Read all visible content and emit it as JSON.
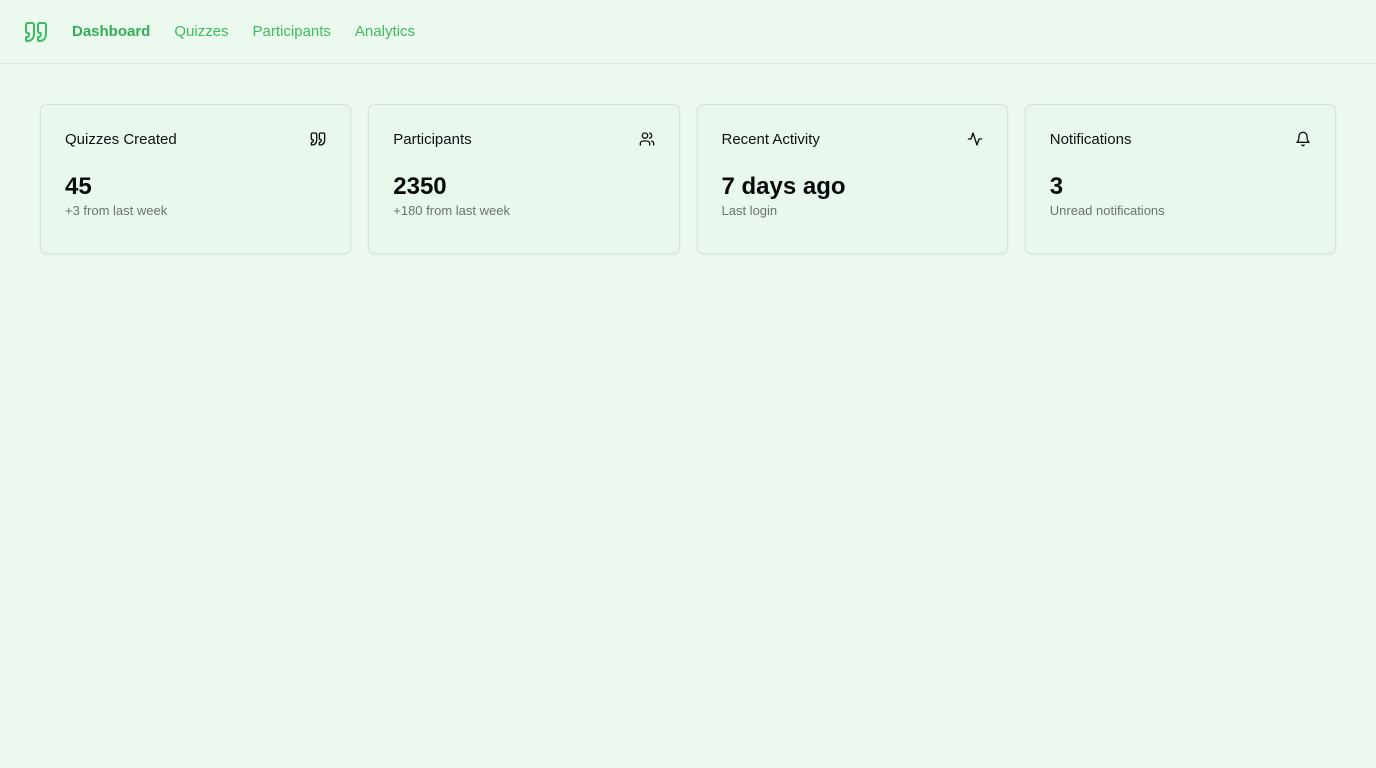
{
  "nav": {
    "logo_icon": "quote-icon",
    "items": [
      {
        "label": "Dashboard",
        "active": true
      },
      {
        "label": "Quizzes",
        "active": false
      },
      {
        "label": "Participants",
        "active": false
      },
      {
        "label": "Analytics",
        "active": false
      }
    ]
  },
  "cards": [
    {
      "title": "Quizzes Created",
      "icon": "quote-icon",
      "value": "45",
      "sub": "+3 from last week"
    },
    {
      "title": "Participants",
      "icon": "users-icon",
      "value": "2350",
      "sub": "+180 from last week"
    },
    {
      "title": "Recent Activity",
      "icon": "activity-icon",
      "value": "7 days ago",
      "sub": "Last login"
    },
    {
      "title": "Notifications",
      "icon": "bell-icon",
      "value": "3",
      "sub": "Unread notifications"
    }
  ],
  "colors": {
    "accent": "#3ebd5f",
    "background": "#ebf9ee",
    "card": "#e8f8ec",
    "muted_text": "#6b746e"
  }
}
